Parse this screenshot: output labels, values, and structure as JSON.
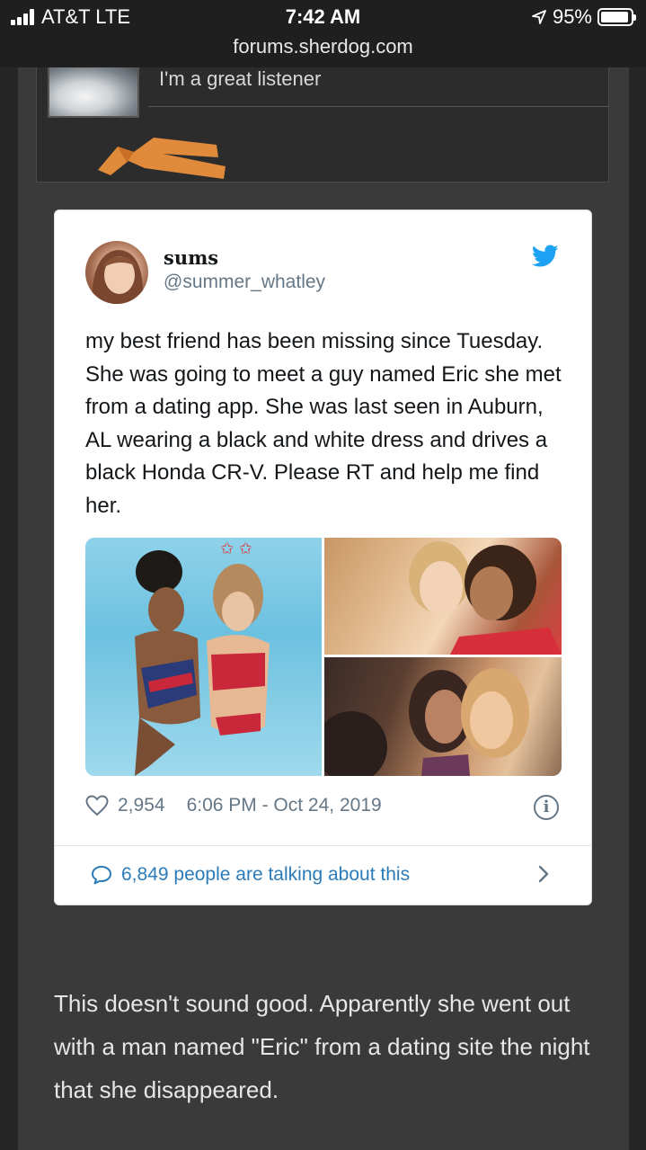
{
  "status_bar": {
    "carrier": "AT&T LTE",
    "time": "7:42 AM",
    "battery": "95%",
    "battery_level": 0.95
  },
  "browser": {
    "url": "forums.sherdog.com"
  },
  "previous_post": {
    "signature": "I'm a great listener",
    "belt_color": "#e08a3c"
  },
  "tweet": {
    "name": "sums",
    "handle": "@summer_whatley",
    "text": "my best friend has been missing since Tuesday. She was going to meet a guy named Eric she met from a dating app. She was last seen in Auburn, AL wearing a black and white dress and drives a black Honda CR-V. Please RT and help me find her.",
    "likes": "2,954",
    "timestamp": "6:06 PM - Oct 24, 2019",
    "talking": "6,849 people are talking about this",
    "icons": [
      "twitter-bird-icon",
      "heart-icon",
      "info-icon",
      "speech-bubble-icon",
      "chevron-right-icon"
    ],
    "colors": {
      "bird": "#1da1f2",
      "link": "#2b7bb9",
      "muted": "#657786"
    }
  },
  "post": {
    "text": "This doesn't sound good. Apparently she went out with a man named \"Eric\" from a dating site the night that she disappeared."
  }
}
